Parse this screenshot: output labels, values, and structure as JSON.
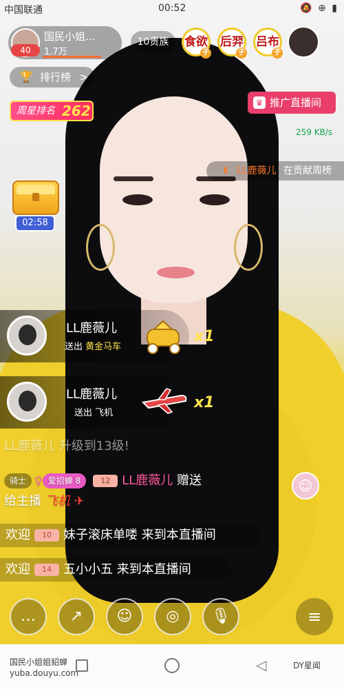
{
  "status_bar": {
    "carrier": "中国联通",
    "time": "00:52",
    "icons": "🔕 ⊕ ▮"
  },
  "host": {
    "name": "国民小姐…",
    "fans": "1.7万",
    "level": "40"
  },
  "noble": "10贵族",
  "fan_badges": [
    {
      "label": "食欲",
      "sub": "子"
    },
    {
      "label": "后羿",
      "sub": "子"
    },
    {
      "label": "吕布",
      "sub": "子"
    }
  ],
  "ranking": {
    "label": "排行榜",
    "chevron": ">"
  },
  "weekly_rank": {
    "label": "周星排名",
    "value": "262"
  },
  "promote": {
    "label": "推广直播间"
  },
  "network_speed": "259 KB/s",
  "contribution": {
    "name": "LL鹿薇儿",
    "text": "在贡献周榜"
  },
  "treasure_timer": "02:58",
  "gifts": [
    {
      "user": "LL鹿薇儿",
      "prefix": "送出",
      "gift": "黄金马车",
      "multiplier": "x1"
    },
    {
      "user": "LL鹿薇儿",
      "prefix": "送出",
      "gift": "飞机",
      "multiplier": "x1"
    }
  ],
  "chat": {
    "upgrade": "LL鹿薇儿 升级到13级!",
    "gift_msg": {
      "badge_knight": "骑士",
      "badge_fan": "爱招蝉",
      "badge_fan_level": "8",
      "user_level": "12",
      "user": "LL鹿薇儿",
      "verb": "赠送",
      "line2_a": "给主播",
      "gift": "飞机"
    },
    "welcomes": [
      {
        "prefix": "欢迎",
        "level": "10",
        "user": "妹子滚床单喽",
        "suffix": "来到本直播间"
      },
      {
        "prefix": "欢迎",
        "level": "14",
        "user": "五小小五",
        "suffix": "来到本直播间"
      }
    ]
  },
  "toolbar": {
    "chat": "…",
    "share": "↗",
    "emoji": "☺",
    "camera": "◎",
    "mic": "🎙",
    "menu": "≡"
  },
  "navbar": {
    "watermark_line1": "国民小姐姐貂蝉",
    "watermark_line2": "yuba.douyu.com",
    "brand": "DY星闻"
  }
}
